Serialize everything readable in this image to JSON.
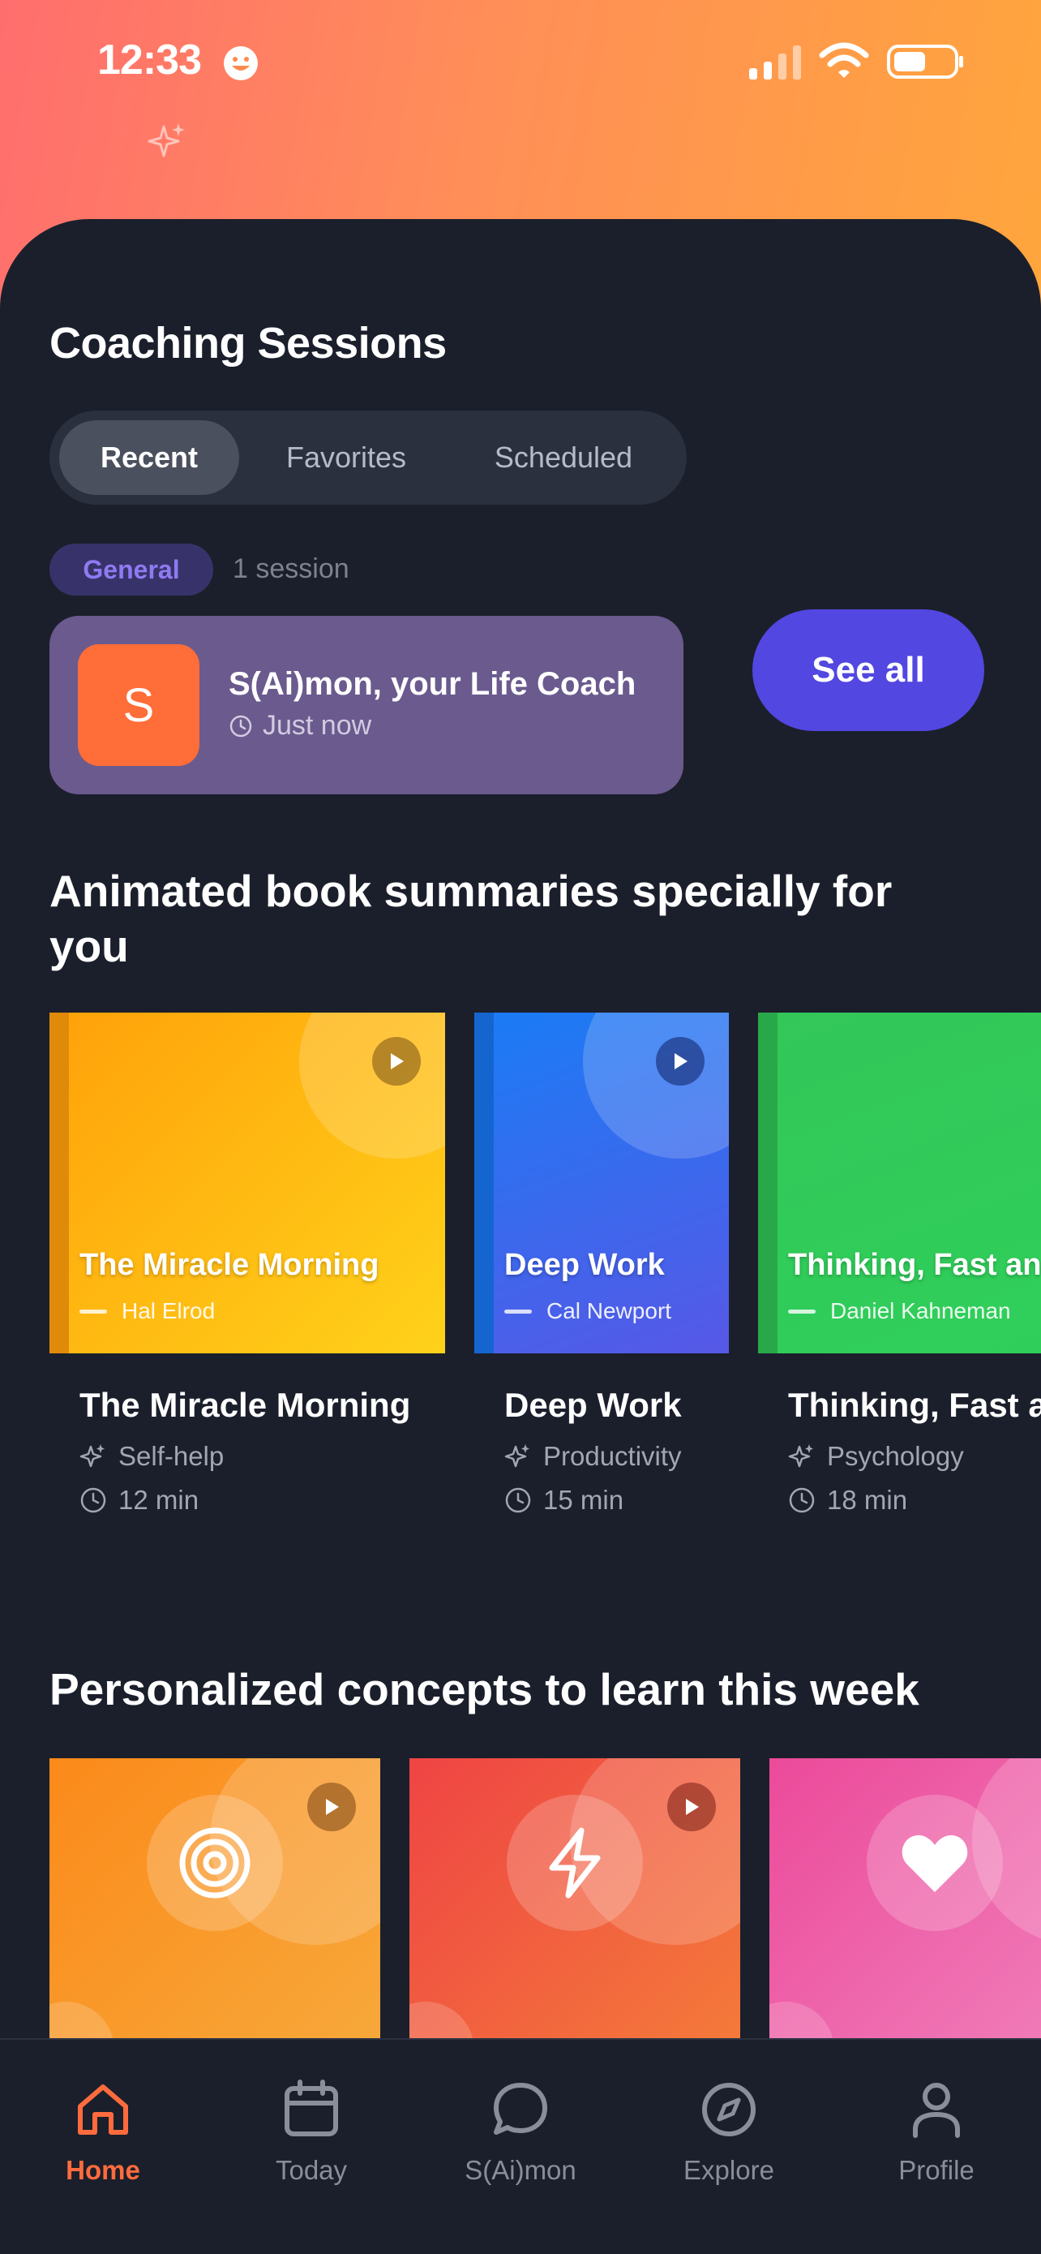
{
  "status_bar": {
    "time": "12:33"
  },
  "coaching": {
    "title": "Coaching Sessions",
    "tabs": [
      {
        "label": "Recent",
        "active": true
      },
      {
        "label": "Favorites",
        "active": false
      },
      {
        "label": "Scheduled",
        "active": false
      }
    ],
    "category_chip": "General",
    "session_count": "1 session",
    "session": {
      "avatar_letter": "S",
      "name": "S(Ai)mon, your Life Coach",
      "time": "Just now"
    },
    "see_all_label": "See all"
  },
  "books": {
    "title": "Animated book summaries specially for you",
    "items": [
      {
        "cover_title": "The Miracle Morning",
        "author": "Hal Elrod",
        "title": "The Miracle Morning",
        "category": "Self-help",
        "duration": "12 min",
        "color_from": "#ffa10a",
        "color_to": "#ffd21a",
        "spine": "#e08a0a"
      },
      {
        "cover_title": "Deep Work",
        "author": "Cal Newport",
        "title": "Deep Work",
        "category": "Productivity",
        "duration": "15 min",
        "color_from": "#1a7cf5",
        "color_to": "#5758e6",
        "spine": "#1565d0"
      },
      {
        "cover_title": "Thinking, Fast and Slow",
        "author": "Daniel Kahneman",
        "title": "Thinking, Fast and Slow",
        "category": "Psychology",
        "duration": "18 min",
        "color_from": "#33c759",
        "color_to": "#2fcf5a",
        "spine": "#29a84a"
      }
    ]
  },
  "concepts": {
    "title": "Personalized concepts to learn this week",
    "items": [
      {
        "icon": "target-icon",
        "color_from": "#fb8a1a",
        "color_to": "#f7a83a"
      },
      {
        "icon": "lightning-icon",
        "color_from": "#ef4444",
        "color_to": "#f47a3a"
      },
      {
        "icon": "heart-icon",
        "color_from": "#ec4a9a",
        "color_to": "#f07ab8"
      }
    ]
  },
  "nav": {
    "items": [
      {
        "label": "Home",
        "icon": "home-icon",
        "active": true
      },
      {
        "label": "Today",
        "icon": "calendar-icon",
        "active": false
      },
      {
        "label": "S(Ai)mon",
        "icon": "chat-icon",
        "active": false
      },
      {
        "label": "Explore",
        "icon": "compass-icon",
        "active": false
      },
      {
        "label": "Profile",
        "icon": "profile-icon",
        "active": false
      }
    ]
  },
  "colors": {
    "background": "#1b1f2b",
    "accent": "#5247e0",
    "active_nav": "#ff6b3d",
    "session_card": "#6b5a8e"
  }
}
